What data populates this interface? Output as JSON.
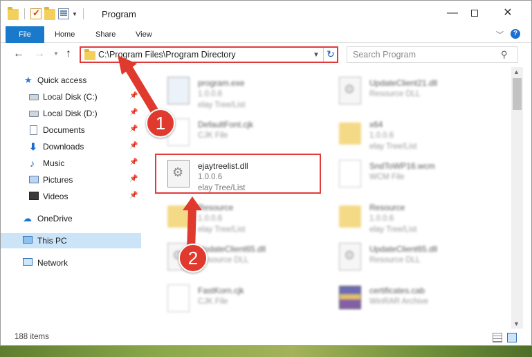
{
  "window": {
    "title": "Program",
    "controls": {
      "minimize": "—",
      "maximize": "",
      "close": "✕"
    }
  },
  "ribbon": {
    "tabs": [
      {
        "label": "File"
      },
      {
        "label": "Home"
      },
      {
        "label": "Share"
      },
      {
        "label": "View"
      }
    ],
    "help": "?"
  },
  "address_bar": {
    "path": "C:\\Program Files\\Program Directory",
    "search_placeholder": "Search Program"
  },
  "nav_pane": {
    "quick_access": "Quick access",
    "items": [
      {
        "label": "Local Disk (C:)",
        "icon": "disk-icon",
        "pinned": true
      },
      {
        "label": "Local Disk (D:)",
        "icon": "disk-icon",
        "pinned": true
      },
      {
        "label": "Documents",
        "icon": "documents-icon",
        "pinned": true
      },
      {
        "label": "Downloads",
        "icon": "downloads-icon",
        "pinned": true
      },
      {
        "label": "Music",
        "icon": "music-icon",
        "pinned": true
      },
      {
        "label": "Pictures",
        "icon": "pictures-icon",
        "pinned": true
      },
      {
        "label": "Videos",
        "icon": "videos-icon",
        "pinned": true
      }
    ],
    "onedrive": "OneDrive",
    "this_pc": "This PC",
    "network": "Network"
  },
  "files": [
    {
      "name": "program.exe",
      "line2": "1.0.0.6",
      "line3": "elay Tree/List",
      "type": "exe"
    },
    {
      "name": "UpdateClient21.dll",
      "line2": "Resource DLL",
      "line3": "",
      "type": "dll"
    },
    {
      "name": "DefaultFont.cjk",
      "line2": "CJK File",
      "line3": "",
      "type": "doc"
    },
    {
      "name": "x64",
      "line2": "1.0.0.6",
      "line3": "elay Tree/List",
      "type": "folder"
    },
    {
      "name": "ejaytreelist.dll",
      "line2": "1.0.0.6",
      "line3": "elay Tree/List",
      "type": "dll"
    },
    {
      "name": "SndToWP16.wcm",
      "line2": "WCM File",
      "line3": "",
      "type": "doc"
    },
    {
      "name": "Resource",
      "line2": "1.0.0.6",
      "line3": "elay Tree/List",
      "type": "folder"
    },
    {
      "name": "Resource",
      "line2": "1.0.0.6",
      "line3": "elay Tree/List",
      "type": "folder"
    },
    {
      "name": "UpdateClient65.dll",
      "line2": "Resource DLL",
      "line3": "",
      "type": "dll"
    },
    {
      "name": "UpdateClient65.dll",
      "line2": "Resource DLL",
      "line3": "",
      "type": "dll"
    },
    {
      "name": "FastKorn.cjk",
      "line2": "CJK File",
      "line3": "",
      "type": "doc"
    },
    {
      "name": "certificates.cab",
      "line2": "WinRAR Archive",
      "line3": "",
      "type": "cab"
    }
  ],
  "status": {
    "item_count": "188 items"
  },
  "annotations": {
    "step1": "1",
    "step2": "2"
  },
  "colors": {
    "accent": "#1979ca",
    "highlight": "#e23a3a",
    "selection": "#cce4f7"
  }
}
